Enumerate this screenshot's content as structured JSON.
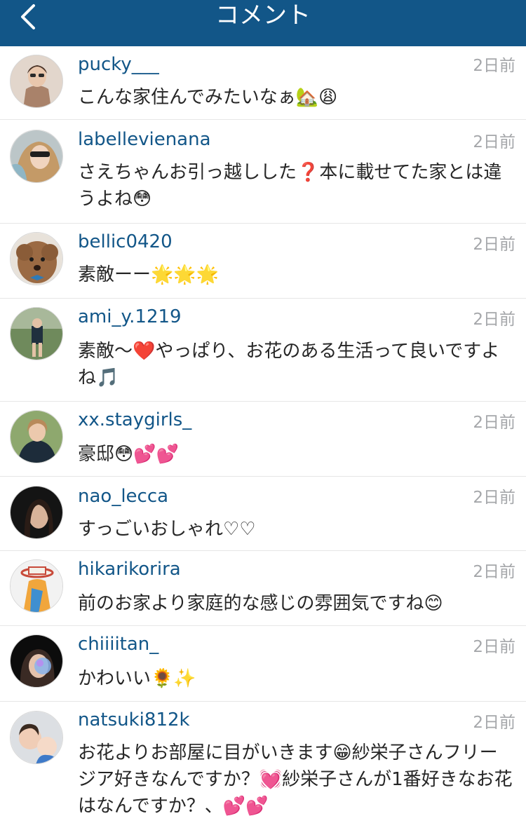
{
  "header": {
    "title": "コメント",
    "back_icon": "chevron-left-icon"
  },
  "colors": {
    "nav_bg": "#125688",
    "username": "#125688",
    "time": "#a5a7aa",
    "text": "#262626"
  },
  "comments": [
    {
      "username": "pucky___",
      "time": "2日前",
      "text": "こんな家住んでみたいなぁ🏡😩",
      "avatar": "avatar-1"
    },
    {
      "username": "labellevienana",
      "time": "2日前",
      "text": "さえちゃんお引っ越しした❓本に載せてた家とは違うよね😳",
      "avatar": "avatar-2"
    },
    {
      "username": "bellic0420",
      "time": "2日前",
      "text": "素敵ーー🌟🌟🌟",
      "avatar": "avatar-3"
    },
    {
      "username": "ami_y.1219",
      "time": "2日前",
      "text": "素敵〜❤️やっぱり、お花のある生活って良いですよね🎵",
      "avatar": "avatar-4"
    },
    {
      "username": "xx.staygirls_",
      "time": "2日前",
      "text": "豪邸😳💕💕",
      "avatar": "avatar-5"
    },
    {
      "username": "nao_lecca",
      "time": "2日前",
      "text": "すっごいおしゃれ♡♡",
      "avatar": "avatar-6"
    },
    {
      "username": "hikarikorira",
      "time": "2日前",
      "text": "前のお家より家庭的な感じの雰囲気ですね😊",
      "avatar": "avatar-7"
    },
    {
      "username": "chiiiitan_",
      "time": "2日前",
      "text": "かわいい🌻✨",
      "avatar": "avatar-8"
    },
    {
      "username": "natsuki812k",
      "time": "2日前",
      "text": "お花よりお部屋に目がいきます😁紗栄子さんフリージア好きなんですか？💓紗栄子さんが1番好きなお花はなんですか？、💕💕",
      "avatar": "avatar-9"
    }
  ]
}
